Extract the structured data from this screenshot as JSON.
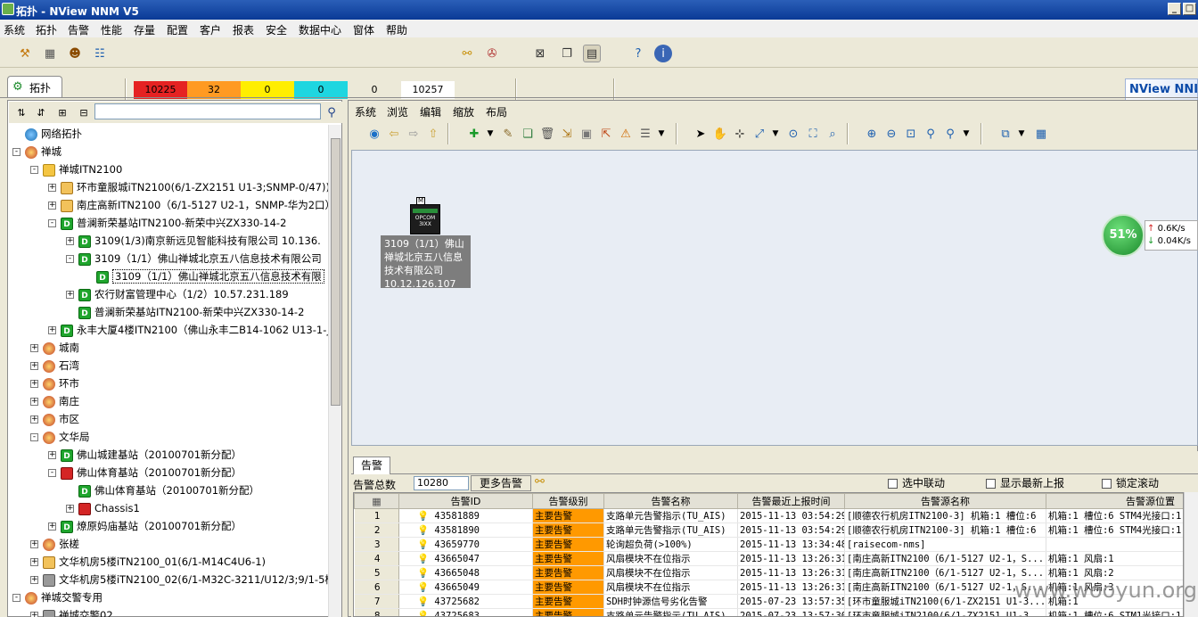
{
  "window": {
    "title": "拓扑 - NView NNM V5"
  },
  "menu": [
    "系统",
    "拓扑",
    "告警",
    "性能",
    "存量",
    "配置",
    "客户",
    "报表",
    "安全",
    "数据中心",
    "窗体",
    "帮助"
  ],
  "severity_counts": [
    {
      "value": "10225",
      "color": "#e52222"
    },
    {
      "value": "32",
      "color": "#ff9a22"
    },
    {
      "value": "0",
      "color": "#ffee00"
    },
    {
      "value": "0",
      "color": "#1fd6e0"
    },
    {
      "value": "0",
      "color": "#ece9d8"
    },
    {
      "value": "10257",
      "color": "#ffffff"
    }
  ],
  "brand": "NView NNI",
  "tab": {
    "label": "拓扑"
  },
  "tree": [
    {
      "level": 0,
      "toggle": "",
      "icon": "net",
      "label": "网络拓扑"
    },
    {
      "level": 0,
      "toggle": "-",
      "icon": "region",
      "label": "禅城"
    },
    {
      "level": 1,
      "toggle": "-",
      "icon": "folder",
      "label": "禅城ITN2100"
    },
    {
      "level": 2,
      "toggle": "+",
      "icon": "dev",
      "label": "环市童服城iTN2100(6/1-ZX2151 U1-3;SNMP-0/47))"
    },
    {
      "level": 2,
      "toggle": "+",
      "icon": "dev",
      "label": "南庄高新ITN2100（6/1-5127 U2-1，SNMP-华为2口）"
    },
    {
      "level": 2,
      "toggle": "-",
      "icon": "d",
      "label": "普澜新荣基站ITN2100-新荣中兴ZX330-14-2"
    },
    {
      "level": 3,
      "toggle": "+",
      "icon": "d",
      "label": "3109(1/3)南京新远见智能科技有限公司 10.136."
    },
    {
      "level": 3,
      "toggle": "-",
      "icon": "d",
      "label": "3109（1/1）佛山禅城北京五八信息技术有限公司"
    },
    {
      "level": 4,
      "toggle": "",
      "icon": "d",
      "label": "3109（1/1）佛山禅城北京五八信息技术有限",
      "selected": true
    },
    {
      "level": 3,
      "toggle": "+",
      "icon": "d",
      "label": "农行财富管理中心（1/2）10.57.231.189"
    },
    {
      "level": 3,
      "toggle": "",
      "icon": "d",
      "label": "普澜新荣基站ITN2100-新荣中兴ZX330-14-2"
    },
    {
      "level": 2,
      "toggle": "+",
      "icon": "d",
      "label": "永丰大厦4楼ITN2100（佛山永丰二B14-1062 U13-1-J"
    },
    {
      "level": 1,
      "toggle": "+",
      "icon": "region",
      "label": "城南"
    },
    {
      "level": 1,
      "toggle": "+",
      "icon": "region",
      "label": "石湾"
    },
    {
      "level": 1,
      "toggle": "+",
      "icon": "region",
      "label": "环市"
    },
    {
      "level": 1,
      "toggle": "+",
      "icon": "region",
      "label": "南庄"
    },
    {
      "level": 1,
      "toggle": "+",
      "icon": "region",
      "label": "市区"
    },
    {
      "level": 1,
      "toggle": "-",
      "icon": "region",
      "label": "文华局"
    },
    {
      "level": 2,
      "toggle": "+",
      "icon": "d",
      "label": "佛山城建基站（20100701新分配）"
    },
    {
      "level": 2,
      "toggle": "-",
      "icon": "red",
      "label": "佛山体育基站（20100701新分配）"
    },
    {
      "level": 3,
      "toggle": "",
      "icon": "d",
      "label": "佛山体育基站（20100701新分配）"
    },
    {
      "level": 3,
      "toggle": "+",
      "icon": "red",
      "label": "Chassis1"
    },
    {
      "level": 2,
      "toggle": "+",
      "icon": "d",
      "label": "燎原妈庙基站（20100701新分配）"
    },
    {
      "level": 1,
      "toggle": "+",
      "icon": "region",
      "label": "张槎"
    },
    {
      "level": 1,
      "toggle": "+",
      "icon": "dev",
      "label": "文华机房5楼iTN2100_01(6/1-M14C4U6-1)"
    },
    {
      "level": 1,
      "toggle": "+",
      "icon": "gray",
      "label": "文华机房5楼iTN2100_02(6/1-M32C-3211/U12/3;9/1-5楼"
    },
    {
      "level": 0,
      "toggle": "-",
      "icon": "region",
      "label": "禅城交警专用"
    },
    {
      "level": 1,
      "toggle": "+",
      "icon": "gray",
      "label": "禅城交警02"
    }
  ],
  "right_menu": [
    "系统",
    "浏览",
    "编辑",
    "缩放",
    "布局"
  ],
  "topology": {
    "device_marker": "M",
    "device_text": "OPCOM 3IXX",
    "node_label": "3109（1/1）佛山禅城北京五八信息技术有限公司10.12.126.107",
    "gauge": "51%",
    "traffic_up": "0.6K/s",
    "traffic_down": "0.04K/s"
  },
  "alarms": {
    "tab_label": "告警",
    "total_label": "告警总数",
    "total_value": "10280",
    "more_button": "更多告警",
    "options": [
      "选中联动",
      "显示最新上报",
      "锁定滚动"
    ],
    "columns": [
      "",
      "告警ID",
      "告警级别",
      "告警名称",
      "告警最近上报时间",
      "告警源名称",
      "告警源位置"
    ],
    "rows": [
      {
        "n": "1",
        "id": "43581889",
        "level": "主要告警",
        "name": "支路单元告警指示(TU_AIS)",
        "time": "2015-11-13 03:54:29",
        "src": "[顺德农行机房ITN2100-3] 机箱:1 槽位:6",
        "loc": "机箱:1 槽位:6 STM4光接口:1"
      },
      {
        "n": "2",
        "id": "43581890",
        "level": "主要告警",
        "name": "支路单元告警指示(TU_AIS)",
        "time": "2015-11-13 03:54:29",
        "src": "[顺德农行机房ITN2100-3] 机箱:1 槽位:6",
        "loc": "机箱:1 槽位:6 STM4光接口:1"
      },
      {
        "n": "3",
        "id": "43659770",
        "level": "主要告警",
        "name": "轮询超负荷(>100%)",
        "time": "2015-11-13 13:34:48",
        "src": "[raisecom-nms]",
        "loc": ""
      },
      {
        "n": "4",
        "id": "43665047",
        "level": "主要告警",
        "name": "风扇模块不在位指示",
        "time": "2015-11-13 13:26:31",
        "src": "[南庄高新ITN2100（6/1-5127 U2-1，S...",
        "loc": "机箱:1 风扇:1"
      },
      {
        "n": "5",
        "id": "43665048",
        "level": "主要告警",
        "name": "风扇模块不在位指示",
        "time": "2015-11-13 13:26:31",
        "src": "[南庄高新ITN2100（6/1-5127 U2-1，S...",
        "loc": "机箱:1 风扇:2"
      },
      {
        "n": "6",
        "id": "43665049",
        "level": "主要告警",
        "name": "风扇模块不在位指示",
        "time": "2015-11-13 13:26:31",
        "src": "[南庄高新ITN2100（6/1-5127 U2-1，S...",
        "loc": "机箱:1 风扇:3"
      },
      {
        "n": "7",
        "id": "43725682",
        "level": "主要告警",
        "name": "SDH时钟源信号劣化告警",
        "time": "2015-07-23 13:57:35",
        "src": "[环市童服城iTN2100(6/1-ZX2151 U1-3...",
        "loc": "机箱:1"
      },
      {
        "n": "8",
        "id": "43725683",
        "level": "主要告警",
        "name": "支路单元告警指示(TU_AIS)",
        "time": "2015-07-23 13:57:30",
        "src": "[环市童服城iTN2100(6/1-ZX2151 U1-3...",
        "loc": "机箱:1 槽位:6 STM1光接口:1"
      }
    ]
  },
  "watermark": "www.wooyun.org"
}
